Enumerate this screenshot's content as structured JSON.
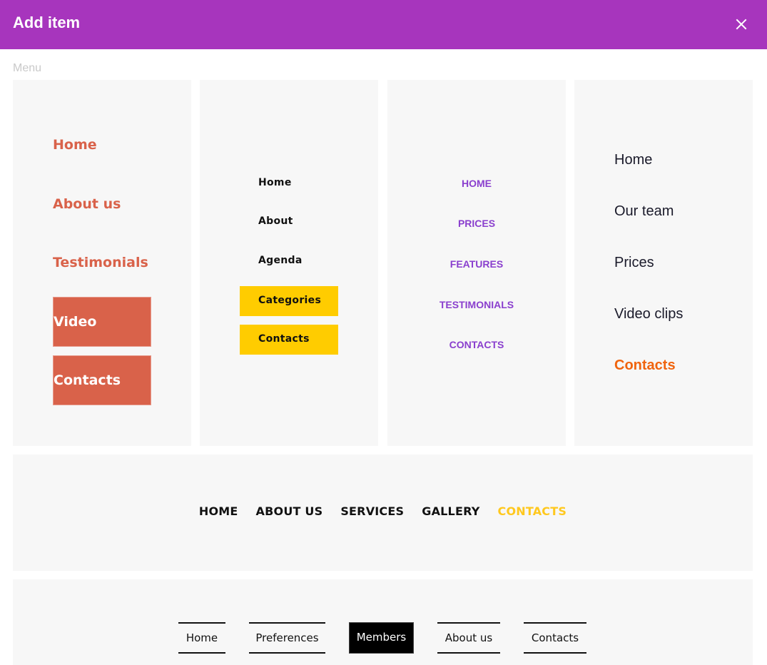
{
  "dialog": {
    "title": "Add item",
    "close_icon": "close-icon",
    "section_label": "Menu"
  },
  "menus": {
    "menu1": {
      "items": [
        "Home",
        "About us",
        "Testimonials"
      ],
      "buttons": [
        "Video",
        "Contacts"
      ],
      "color": "#d9624a"
    },
    "menu2": {
      "items": [
        "Home",
        "About",
        "Agenda"
      ],
      "buttons": [
        "Categories",
        "Contacts"
      ],
      "button_color": "#ffcc00"
    },
    "menu3": {
      "items": [
        "HOME",
        "PRICES",
        "FEATURES",
        "TESTIMONIALS",
        "CONTACTS"
      ],
      "color": "#8a3fce"
    },
    "menu4": {
      "items": [
        "Home",
        "Our team",
        "Prices",
        "Video clips",
        "Contacts"
      ],
      "active": "Contacts",
      "active_color": "#f0640e"
    },
    "menu5": {
      "items": [
        "HOME",
        "ABOUT US",
        "SERVICES",
        "GALLERY",
        "CONTACTS"
      ],
      "active": "CONTACTS",
      "active_color": "#ffc81e"
    },
    "menu6": {
      "items": [
        "Home",
        "Preferences",
        "Members",
        "About us",
        "Contacts"
      ],
      "active": "Members"
    }
  },
  "colors": {
    "header": "#a735bd",
    "panel_bg": "#f7f7f7"
  }
}
